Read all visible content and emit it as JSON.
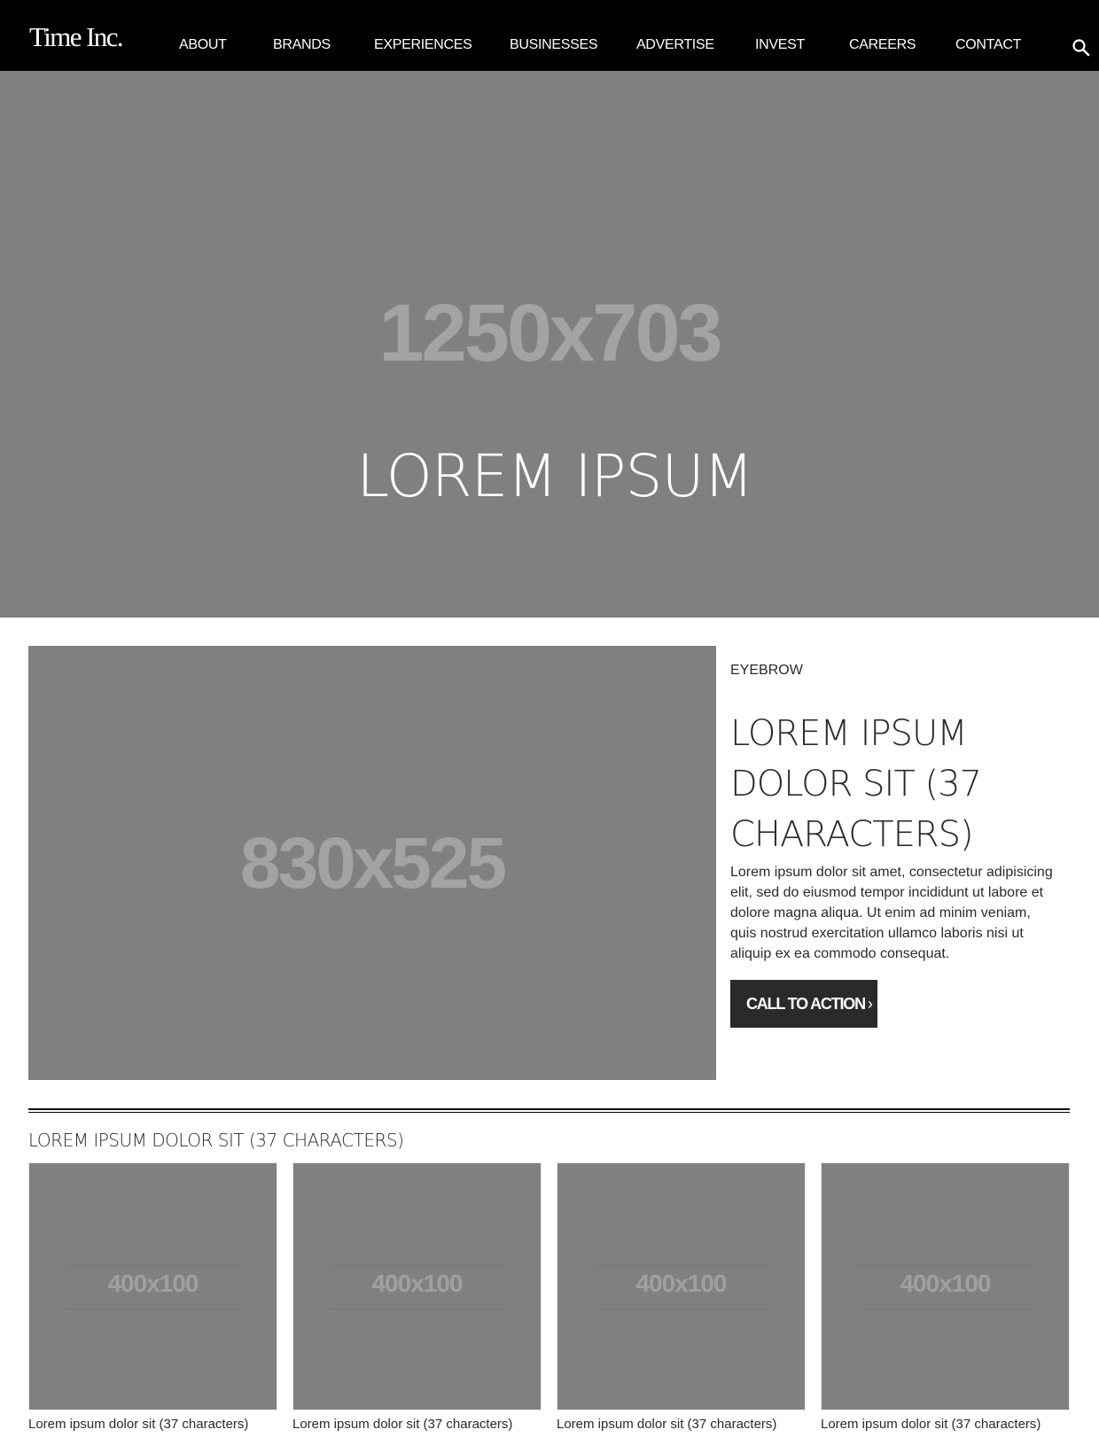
{
  "header": {
    "logo": "Time Inc.",
    "nav": [
      {
        "label": "ABOUT"
      },
      {
        "label": "BRANDS"
      },
      {
        "label": "EXPERIENCES"
      },
      {
        "label": "BUSINESSES"
      },
      {
        "label": "ADVERTISE"
      },
      {
        "label": "INVEST"
      },
      {
        "label": "CAREERS"
      },
      {
        "label": "CONTACT"
      }
    ],
    "search_icon": "search-icon"
  },
  "hero": {
    "placeholder_size": "1250x703",
    "title": "LOREM IPSUM"
  },
  "feature": {
    "placeholder_size": "830x525",
    "eyebrow": "EYEBROW",
    "title": "LOREM IPSUM DOLOR SIT (37 CHARACTERS)",
    "body": "Lorem ipsum dolor sit amet, consectetur adipisicing elit, sed do eiusmod tempor incididunt ut labore et dolore magna aliqua. Ut enim ad minim veniam, quis nostrud exercitation ullamco laboris nisi ut aliquip ex ea commodo consequat.",
    "cta_label": "CALL TO ACTION",
    "cta_icon": "chevron-right-icon"
  },
  "section": {
    "title": "LOREM IPSUM DOLOR SIT (37 CHARACTERS)",
    "cards": [
      {
        "placeholder_size": "400x100",
        "caption": "Lorem ipsum dolor sit (37 characters)"
      },
      {
        "placeholder_size": "400x100",
        "caption": "Lorem ipsum dolor sit (37 characters)"
      },
      {
        "placeholder_size": "400x100",
        "caption": "Lorem ipsum dolor sit (37 characters)"
      },
      {
        "placeholder_size": "400x100",
        "caption": "Lorem ipsum dolor sit (37 characters)"
      }
    ]
  },
  "colors": {
    "header_bg": "#000000",
    "placeholder_bg": "#808080",
    "placeholder_text": "#a3a3a3",
    "text": "#2a2a2a",
    "cta_bg": "#2a2a2a"
  }
}
